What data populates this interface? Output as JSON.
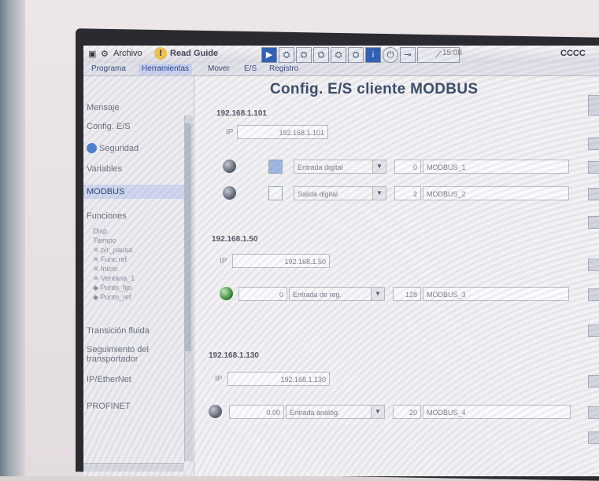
{
  "menubar": {
    "archive_label": "Archivo",
    "brand_label": "Read Guide",
    "status_text": "15:08",
    "code_text": "CCCC"
  },
  "tabs": [
    "Programa",
    "Herramientas",
    "Mover",
    "E/S",
    "Registro"
  ],
  "sidebar": {
    "items": [
      "Mensaje",
      "Config. E/S",
      "Seguridad",
      "Variables",
      "MODBUS",
      "Funciones"
    ],
    "subitems": [
      "Disp.",
      "Tiempo",
      "p/r_pausa",
      "Func.ref",
      "Inicio",
      "Ventana_1",
      "Punto_fijo",
      "Punto_ref"
    ],
    "items_bottom": [
      "Transición fluida",
      "Seguimiento del transportador",
      "IP/EtherNet",
      "PROFINET"
    ],
    "selected": "MODBUS"
  },
  "main": {
    "title": "Config. E/S cliente MODBUS",
    "groups": [
      {
        "header": "192.168.1.101",
        "ip_label": "IP",
        "ip_value": "192.168.1.101",
        "rows": [
          {
            "type": "Entrada digital",
            "index": "0",
            "name": "MODBUS_1",
            "indicator": "grey",
            "square": "blue",
            "input": ""
          },
          {
            "type": "Salida digital",
            "index": "2",
            "name": "MODBUS_2",
            "indicator": "grey",
            "square": "blank",
            "input": ""
          }
        ]
      },
      {
        "header": "192.168.1.50",
        "ip_label": "IP",
        "ip_value": "192.168.1.50",
        "rows": [
          {
            "type": "Entrada de reg.",
            "index": "128",
            "name": "MODBUS_3",
            "indicator": "green",
            "square": "none",
            "input": "0"
          }
        ]
      },
      {
        "header": "192.168.1.130",
        "ip_label": "IP",
        "ip_value": "192.168.1.130",
        "rows": [
          {
            "type": "Entrada analóg.",
            "index": "20",
            "name": "MODBUS_4",
            "indicator": "grey",
            "square": "none",
            "input": "0.00"
          }
        ]
      }
    ]
  },
  "colors": {
    "accent": "#c9d3ef",
    "title": "#3b4c66",
    "bezel": "#e6e0e2",
    "indicator_green": "#2e7a2b"
  }
}
